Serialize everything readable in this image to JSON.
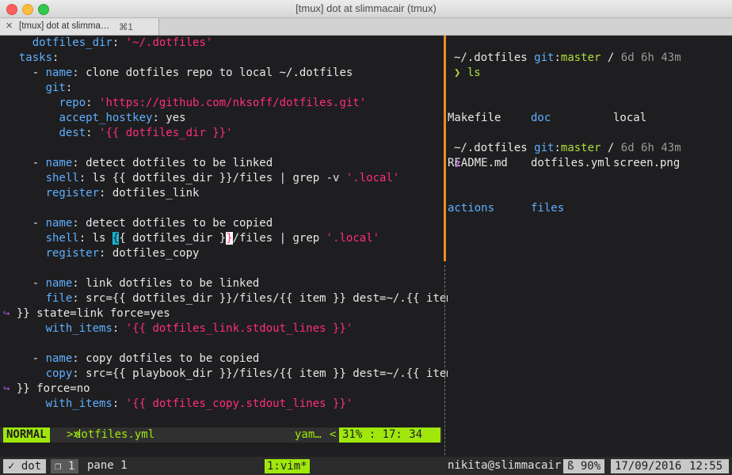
{
  "window": {
    "title": "[tmux] dot at slimmacair (tmux)"
  },
  "tab": {
    "close": "✕",
    "label": "[tmux] dot at slimma…",
    "shortcut": "⌘1"
  },
  "editor": {
    "l1": {
      "k": "dotfiles_dir",
      "p": ": ",
      "s": "'~/.dotfiles'"
    },
    "l2": {
      "k": "tasks",
      "p": ":"
    },
    "l3": {
      "p1": "- ",
      "k": "name",
      "p2": ": clone dotfiles repo to local ~/.dotfiles"
    },
    "l4": {
      "k": "git",
      "p": ":"
    },
    "l5": {
      "k": "repo",
      "p": ": ",
      "s": "'https://github.com/nksoff/dotfiles.git'"
    },
    "l6": {
      "k": "accept_hostkey",
      "p": ": yes"
    },
    "l7": {
      "k": "dest",
      "p": ": ",
      "s": "'{{ dotfiles_dir }}'"
    },
    "l8": {
      "p1": "- ",
      "k": "name",
      "p2": ": detect dotfiles to be linked"
    },
    "l9": {
      "k": "shell",
      "p": ": ls {{ dotfiles_dir }}/files | grep -v ",
      "s": "'.local'"
    },
    "l10": {
      "k": "register",
      "p": ": dotfiles_link"
    },
    "l11": {
      "p1": "- ",
      "k": "name",
      "p2": ": detect dotfiles to be copied"
    },
    "l12": {
      "k": "shell",
      "p1": ": ls ",
      "c1": "{",
      "p2": "{ dotfiles_dir }",
      "c2": "}",
      "p3": "/files | grep ",
      "s": "'.local'"
    },
    "l13": {
      "k": "register",
      "p": ": dotfiles_copy"
    },
    "l14": {
      "p1": "- ",
      "k": "name",
      "p2": ": link dotfiles to be linked"
    },
    "l15": {
      "k": "file",
      "p": ": src={{ dotfiles_dir }}/files/{{ item }} dest=~/.{{ item"
    },
    "l16": {
      "wrap": "↪",
      "p": " }} state=link force=yes"
    },
    "l17": {
      "k": "with_items",
      "p": ": ",
      "s": "'{{ dotfiles_link.stdout_lines }}'"
    },
    "l18": {
      "p1": "- ",
      "k": "name",
      "p2": ": copy dotfiles to be copied"
    },
    "l19": {
      "k": "copy",
      "p": ": src={{ playbook_dir }}/files/{{ item }} dest=~/.{{ item"
    },
    "l20": {
      "wrap": "↪",
      "p": " }} force=no"
    },
    "l21": {
      "k": "with_items",
      "p": ": ",
      "s": "'{{ dotfiles_copy.stdout_lines }}'"
    }
  },
  "vimstatus": {
    "mode": "NORMAL",
    "sep1": ">>",
    "file": "dotfiles.yml",
    "filetype": "yam…",
    "sep2": "<",
    "position": "31% :  17: 34"
  },
  "shell": {
    "path": "~/.dotfiles",
    "git": "git",
    "colon": ":",
    "branch": "master",
    "slash": " / ",
    "elapsed": "6d 6h 43m",
    "prompt": "❯",
    "command": "ls",
    "ls_col1": [
      "Makefile",
      "README.md",
      "actions"
    ],
    "ls_col2": [
      "doc",
      "dotfiles.yml",
      "files"
    ],
    "ls_col3": [
      "local",
      "screen.png"
    ]
  },
  "tmux": {
    "session": "✓ dot",
    "window_index": "❐ 1",
    "pane": "pane 1",
    "window": "1:vim*",
    "host": "nikita@slimmacair",
    "battery": "ß 90%",
    "date": "17/09/2016",
    "time": "12:55"
  },
  "colors": {
    "keyword": "#5fafff",
    "string": "#ff2e79",
    "accent": "#a0e80c",
    "active_border": "#f08a24"
  }
}
